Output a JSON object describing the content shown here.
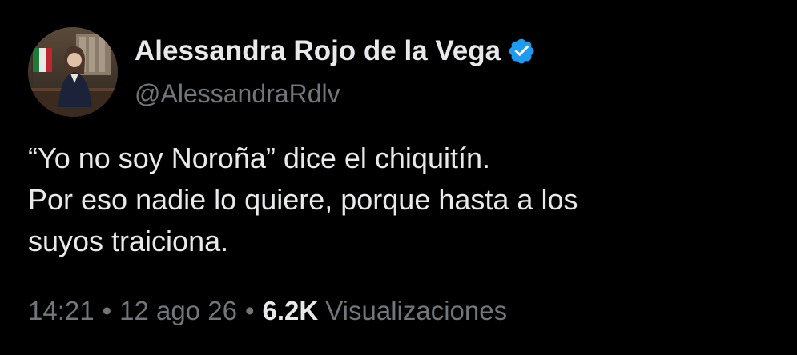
{
  "author": {
    "display_name": "Alessandra Rojo de la Vega",
    "handle": "@AlessandraRdlv",
    "verified": true,
    "verified_icon": "verified-badge-icon",
    "verified_color": "#1d9bf0"
  },
  "tweet": {
    "lines": [
      "“Yo no soy Noroña” dice el chiquitín.",
      "Por eso nadie lo quiere, porque hasta a los",
      "suyos traiciona."
    ]
  },
  "meta": {
    "time": "14:21",
    "separator": "•",
    "date": "12 ago 26",
    "views_count": "6.2K",
    "views_label": "Visualizaciones"
  },
  "colors": {
    "background": "#000000",
    "primary_text": "#e7e9ea",
    "secondary_text": "#71767b"
  }
}
